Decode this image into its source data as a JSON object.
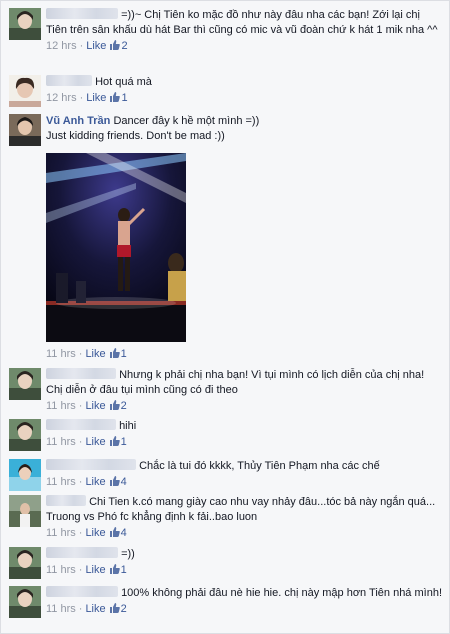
{
  "comments": [
    {
      "text": "=))~ Chị Tiên ko mặc đồ như này đâu nha các bạn! Zới lại chị Tiên trên sân khấu dù hát Bar thì cũng có mic và vũ đoàn chứ k hát 1 mik nha ^^",
      "time": "12 hrs",
      "like": "Like",
      "count": "2"
    },
    {
      "text": "Hot quá mà",
      "time": "12 hrs",
      "like": "Like",
      "count": "1"
    },
    {
      "name": "Vũ Anh Trần",
      "text": "Dancer đây k hề một mình =))",
      "text2": "Just kidding friends. Don't be mad :))",
      "time": "11 hrs",
      "like": "Like",
      "count": "1"
    },
    {
      "text": "Nhưng k phải chị nha bạn! Vì tụi mình có lịch diễn của chị nha! Chị diễn ở đâu tụi mình cũng có đi theo",
      "time": "11 hrs",
      "like": "Like",
      "count": "2"
    },
    {
      "text": "hihi",
      "time": "11 hrs",
      "like": "Like",
      "count": "1"
    },
    {
      "text": "Chắc là tui đó kkkk, Thủy Tiên Phạm nha các chế",
      "time": "11 hrs",
      "like": "Like",
      "count": "4"
    },
    {
      "text": "Chi Tien k.có mang giày cao nhu vay nhảy đâu...tóc bả này ngắn quá... Truong vs Phó fc khẳng định k fải..bao luon",
      "time": "11 hrs",
      "like": "Like",
      "count": "4"
    },
    {
      "text": "=))",
      "time": "11 hrs",
      "like": "Like",
      "count": "1"
    },
    {
      "text": "100% không phải đâu nè hie hie. chị này mập hơn Tiên nhá mình!",
      "time": "11 hrs",
      "like": "Like",
      "count": "2"
    }
  ],
  "colors": {
    "link": "#3b5998",
    "meta": "#9197a3",
    "text": "#141823"
  }
}
